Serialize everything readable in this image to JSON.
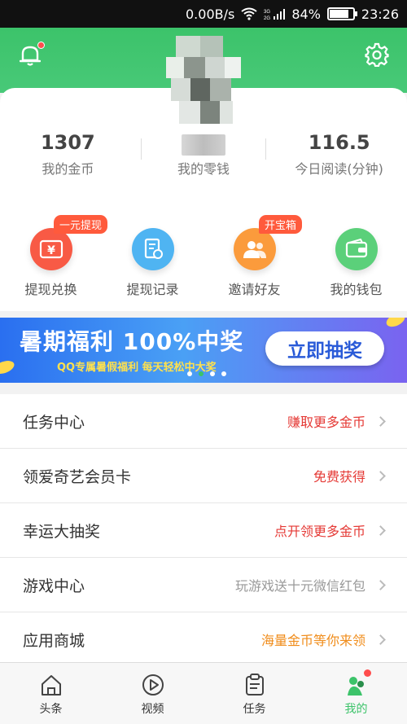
{
  "status": {
    "speed": "0.00B/s",
    "network": "3G 2G",
    "battery": "84%",
    "battery_level": 0.84,
    "time": "23:26"
  },
  "stats": [
    {
      "value": "1307",
      "label": "我的金币"
    },
    {
      "value": "",
      "label": "我的零钱"
    },
    {
      "value": "116.5",
      "label": "今日阅读(分钟)"
    }
  ],
  "quick": [
    {
      "label": "提现兑换",
      "badge": "一元提现",
      "icon": "yuan-wallet-icon",
      "color": "#f85a45"
    },
    {
      "label": "提现记录",
      "badge": "",
      "icon": "record-icon",
      "color": "#4fb4f2"
    },
    {
      "label": "邀请好友",
      "badge": "开宝箱",
      "icon": "friends-icon",
      "color": "#fb9b3c"
    },
    {
      "label": "我的钱包",
      "badge": "",
      "icon": "wallet-icon",
      "color": "#5bd07a"
    }
  ],
  "banner": {
    "title_a": "暑期福利",
    "title_b": "100%中奖",
    "subtitle": "QQ专属暑假福利 每天轻松中大奖",
    "button": "立即抽奖"
  },
  "list": [
    {
      "title": "任务中心",
      "side": "赚取更多金币",
      "color": "#e53935"
    },
    {
      "title": "领爱奇艺会员卡",
      "side": "免费获得",
      "color": "#e53935"
    },
    {
      "title": "幸运大抽奖",
      "side": "点开领更多金币",
      "color": "#e53935"
    },
    {
      "title": "游戏中心",
      "side": "玩游戏送十元微信红包",
      "color": "#999999"
    },
    {
      "title": "应用商城",
      "side": "海量金币等你来领",
      "color": "#f08c1a"
    }
  ],
  "tabs": [
    {
      "label": "头条",
      "icon": "home-icon"
    },
    {
      "label": "视频",
      "icon": "play-icon"
    },
    {
      "label": "任务",
      "icon": "clipboard-icon"
    },
    {
      "label": "我的",
      "icon": "profile-icon",
      "active": true
    }
  ],
  "colors": {
    "brand_green": "#3cc36a"
  }
}
